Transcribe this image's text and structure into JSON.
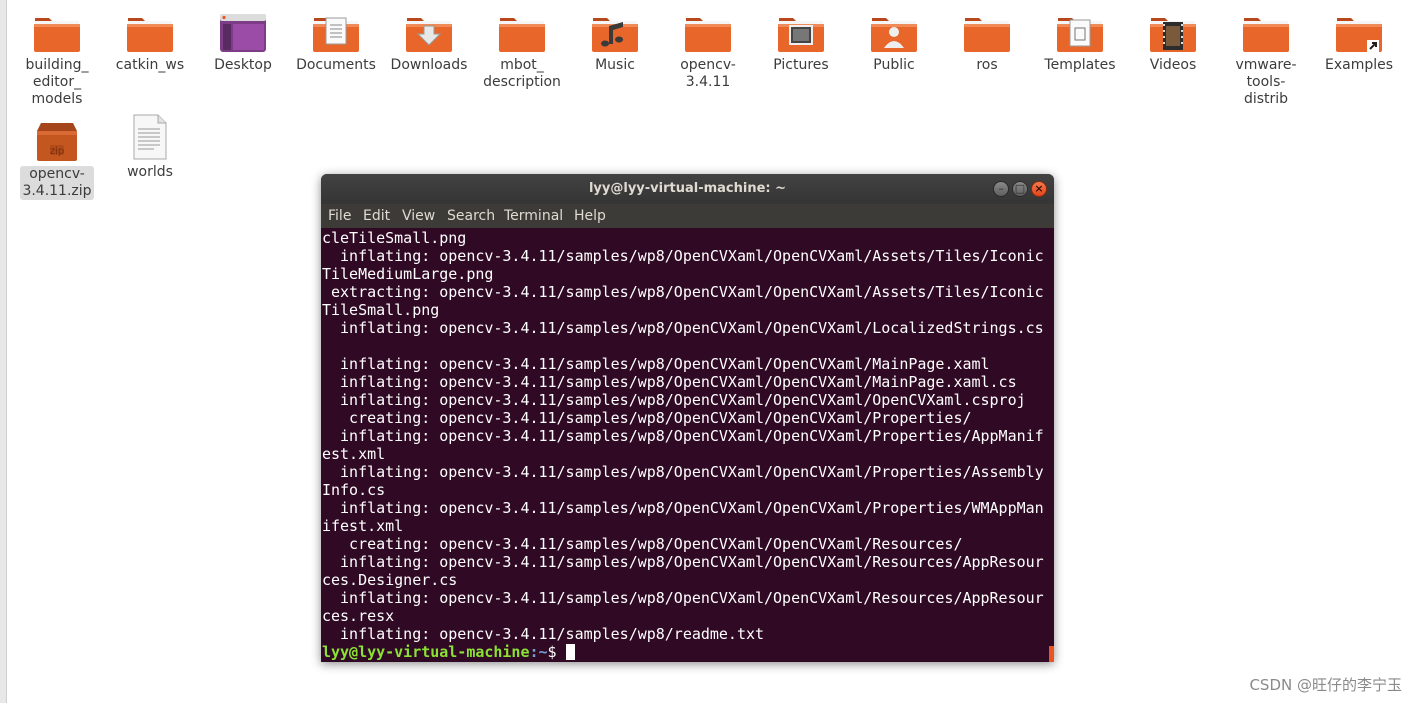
{
  "desktop": {
    "icons": [
      {
        "label": "building_\neditor_\nmodels",
        "type": "folder"
      },
      {
        "label": "catkin_ws",
        "type": "folder"
      },
      {
        "label": "Desktop",
        "type": "desktop-folder"
      },
      {
        "label": "Documents",
        "type": "documents-folder"
      },
      {
        "label": "Downloads",
        "type": "downloads-folder"
      },
      {
        "label": "mbot_\ndescription",
        "type": "folder"
      },
      {
        "label": "Music",
        "type": "music-folder"
      },
      {
        "label": "opencv-\n3.4.11",
        "type": "folder"
      },
      {
        "label": "Pictures",
        "type": "pictures-folder"
      },
      {
        "label": "Public",
        "type": "public-folder"
      },
      {
        "label": "ros",
        "type": "folder"
      },
      {
        "label": "Templates",
        "type": "templates-folder"
      },
      {
        "label": "Videos",
        "type": "videos-folder"
      },
      {
        "label": "vmware-\ntools-\ndistrib",
        "type": "folder"
      },
      {
        "label": "Examples",
        "type": "examples-folder"
      },
      {
        "label": "opencv-\n3.4.11.zip",
        "type": "zip-archive",
        "badge": "zip"
      },
      {
        "label": "worlds",
        "type": "text-file"
      }
    ]
  },
  "terminal": {
    "title": "lyy@lyy-virtual-machine: ~",
    "menu": [
      "File",
      "Edit",
      "View",
      "Search",
      "Terminal",
      "Help"
    ],
    "lines": [
      "cleTileSmall.png",
      "  inflating: opencv-3.4.11/samples/wp8/OpenCVXaml/OpenCVXaml/Assets/Tiles/Iconic",
      "TileMediumLarge.png",
      " extracting: opencv-3.4.11/samples/wp8/OpenCVXaml/OpenCVXaml/Assets/Tiles/Iconic",
      "TileSmall.png",
      "  inflating: opencv-3.4.11/samples/wp8/OpenCVXaml/OpenCVXaml/LocalizedStrings.cs",
      "",
      "  inflating: opencv-3.4.11/samples/wp8/OpenCVXaml/OpenCVXaml/MainPage.xaml",
      "  inflating: opencv-3.4.11/samples/wp8/OpenCVXaml/OpenCVXaml/MainPage.xaml.cs",
      "  inflating: opencv-3.4.11/samples/wp8/OpenCVXaml/OpenCVXaml/OpenCVXaml.csproj",
      "   creating: opencv-3.4.11/samples/wp8/OpenCVXaml/OpenCVXaml/Properties/",
      "  inflating: opencv-3.4.11/samples/wp8/OpenCVXaml/OpenCVXaml/Properties/AppManif",
      "est.xml",
      "  inflating: opencv-3.4.11/samples/wp8/OpenCVXaml/OpenCVXaml/Properties/Assembly",
      "Info.cs",
      "  inflating: opencv-3.4.11/samples/wp8/OpenCVXaml/OpenCVXaml/Properties/WMAppMan",
      "ifest.xml",
      "   creating: opencv-3.4.11/samples/wp8/OpenCVXaml/OpenCVXaml/Resources/",
      "  inflating: opencv-3.4.11/samples/wp8/OpenCVXaml/OpenCVXaml/Resources/AppResour",
      "ces.Designer.cs",
      "  inflating: opencv-3.4.11/samples/wp8/OpenCVXaml/OpenCVXaml/Resources/AppResour",
      "ces.resx",
      "  inflating: opencv-3.4.11/samples/wp8/readme.txt"
    ],
    "prompt": {
      "user_host": "lyy@lyy-virtual-machine",
      "path": ":~",
      "symbol": "$ "
    }
  },
  "watermark": "CSDN @旺仔的李宁玉",
  "colors": {
    "folder_orange": "#e9662b",
    "terminal_bg": "#300a24",
    "prompt_green": "#8ae234",
    "prompt_blue": "#729fcf",
    "close_button": "#e95420"
  }
}
